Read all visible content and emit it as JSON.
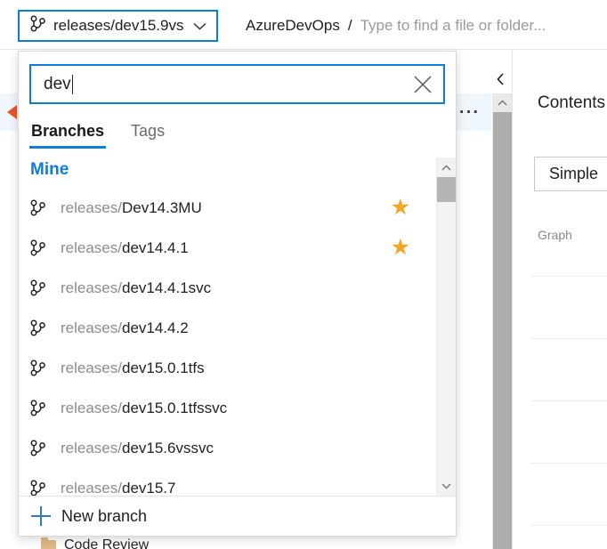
{
  "topbar": {
    "branch_selector": {
      "icon": "git-branch-icon",
      "label": "releases/dev15.9vs",
      "chevron": "chevron-down-icon"
    },
    "breadcrumb": {
      "repo": "AzureDevOps",
      "separator": "/",
      "placeholder": "Type to find a file or folder..."
    }
  },
  "dropdown": {
    "search": {
      "value": "dev",
      "placeholder": "",
      "clear_icon": "close-icon"
    },
    "tabs": [
      {
        "label": "Branches",
        "active": true
      },
      {
        "label": "Tags",
        "active": false
      }
    ],
    "group_title": "Mine",
    "branches": [
      {
        "prefix": "releases/",
        "name": "Dev14.3MU",
        "favorite": true
      },
      {
        "prefix": "releases/",
        "name": "dev14.4.1",
        "favorite": true
      },
      {
        "prefix": "releases/",
        "name": "dev14.4.1svc",
        "favorite": false
      },
      {
        "prefix": "releases/",
        "name": "dev14.4.2",
        "favorite": false
      },
      {
        "prefix": "releases/",
        "name": "dev15.0.1tfs",
        "favorite": false
      },
      {
        "prefix": "releases/",
        "name": "dev15.0.1tfssvc",
        "favorite": false
      },
      {
        "prefix": "releases/",
        "name": "dev15.6vssvc",
        "favorite": false
      },
      {
        "prefix": "releases/",
        "name": "dev15.7",
        "favorite": false
      }
    ],
    "scrollbar": {
      "up_icon": "chevron-up-icon",
      "down_icon": "chevron-down-icon"
    },
    "footer": {
      "icon": "plus-icon",
      "label": "New branch"
    }
  },
  "background": {
    "pointer_icon": "red-arrow-icon",
    "overflow_menu": "···",
    "collapse_icon": "chevron-left-icon",
    "scrollbar_up_icon": "chevron-up-icon",
    "folder_row": {
      "icon": "folder-icon",
      "label": "Code Review"
    }
  },
  "right_panel": {
    "title": "Contents",
    "tab_label": "Simple",
    "section_label": "Graph"
  },
  "colors": {
    "accent": "#0d7ddb",
    "star": "#f5a623",
    "pointer": "#e8542a",
    "muted_text": "#8c8c8c"
  }
}
